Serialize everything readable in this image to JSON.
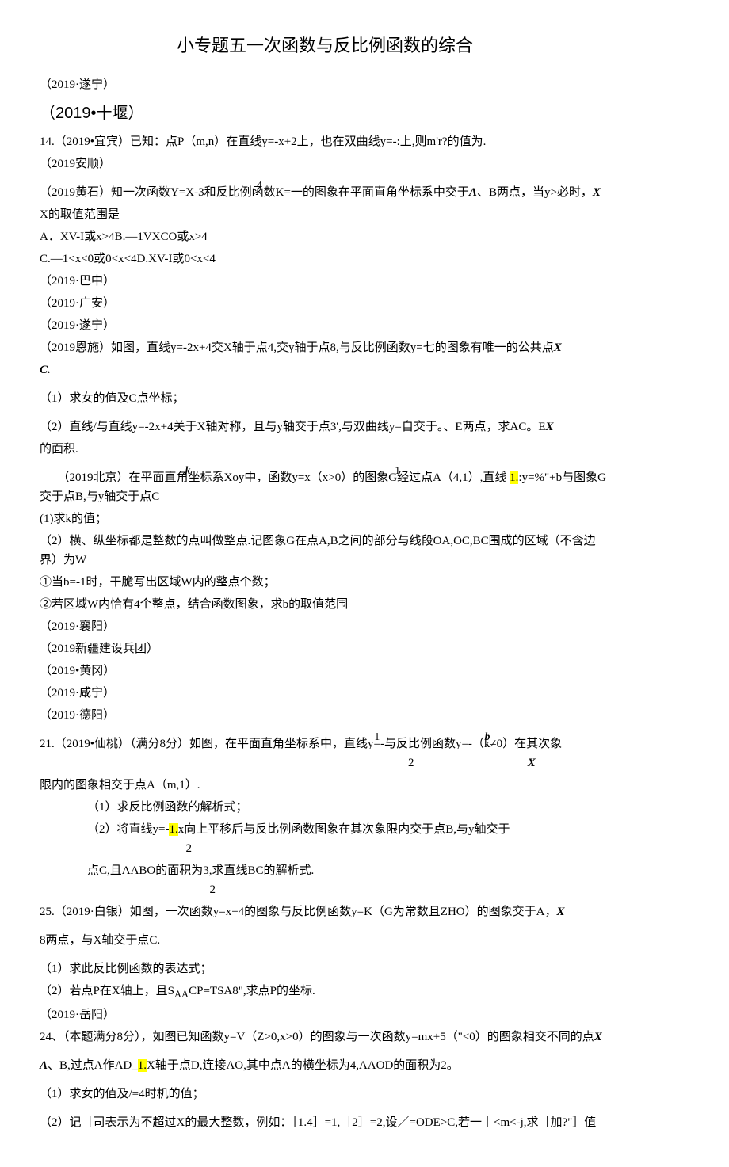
{
  "title": "小专题五一次函数与反比例函数的综合",
  "p1": "（2019·遂宁）",
  "p2": "（2019•十堰）",
  "p3": "14.（2019•宜宾）已知：点P（m,n）在直线y=-x+2上，也在双曲线y=-:上,则m'r?的值为.",
  "p4": "（2019安顺）",
  "p5a": "（2019黄石）知一次函数Y=X-3和反比例函数K=一的图象在平面直角坐标系中交于",
  "p5a_sup": "4",
  "p5_ai": "A",
  "p5b": "、B两点，当y>必时，",
  "p5_xi": "X",
  "p6": "X的取值范围是",
  "p7": "A．XV-I或x>4B.—1VXCO或x>4",
  "p8": "C.—1<x<0或0<x<4D.XV-I或0<x<4",
  "p9": "（2019·巴中）",
  "p10": "（2019·广安）",
  "p11": "（2019·遂宁）",
  "p12a": "（2019恩施）如图，直线y=-2x+4交X轴于点4,交y轴于点8,与反比例函数y=七的图象有唯一的公共点",
  "p12_xi": "X",
  "p13_ci": "C.",
  "p14": "（1）求女的值及C点坐标；",
  "p15a": "（2）直线/与直线y=-2x+4关于X轴对称，且与y轴交于点3',与双曲线y=自交于。、E两点，求AC。E",
  "p15_xi": "X",
  "p16": "的面积.",
  "p17a": "　　（2019北京）在平面直角坐标系Xoy中，函数y=x（x>0）的图象G经过点A（4,1）,直线",
  "p17_sup1": "k",
  "p17_sup2": "1",
  "p17_hl": "1.",
  "p17b": ":y=%\"+b与图象G交于点B,与y轴交于点C",
  "p18": "(1)求k的值；",
  "p19": "（2）横、纵坐标都是整数的点叫做整点.记图象G在点A,B之间的部分与线段OA,OC,BC围成的区域（不含边界）为W",
  "p20": "①当b=-1时，干脆写出区域W内的整点个数；",
  "p21": "②若区域W内恰有4个整点，结合函数图象，求b的取值范围",
  "p22": "（2019·襄阳）",
  "p23": "（2019新疆建设兵团）",
  "p24": "（2019•黄冈）",
  "p25": "（2019·咸宁）",
  "p26": "（2019·德阳）",
  "p27a": "21.（2019•仙桃）（满分8分）如图，在平面直角坐标系中，直线y=-与反比例函数y=-（k≠0）在其次象",
  "p27_sup1": "1",
  "p27_sup2": "b",
  "p27_sub1": "2",
  "p27_sub2": "X",
  "p28": "限内的图象相交于点A（m,1）.",
  "p29": "（1）求反比例函数的解析式；",
  "p30a": "（2）将直线y=-",
  "p30_hl": "1.",
  "p30b": "x向上平移后与反比例函数图象在其次象限内交于点B,与y轴交于",
  "p30_sub": "2",
  "p31a": "点C,且AABO的面积为3,求直线BC的解析式.",
  "p31_sub": "2",
  "p32a": "25.（2019·白银）如图，一次函数y=x+4的图象与反比例函数y=K（G为常数且ZHO）的图象交于A，",
  "p32_xi": "X",
  "p33": "8两点，与X轴交于点C.",
  "p34": "（1）求此反比例函数的表达式；",
  "p35": "（2）若点P在X轴上，且S",
  "p35_sub": "AA",
  "p35b": "CP=TSA8\",求点P的坐标.",
  "p36": "（2019·岳阳）",
  "p37a": "24、（本题满分8分），如图已知函数y=V（Z>0,x>0）的图象与一次函数y=mx+5（\"<0）的图象相交不同的点",
  "p37_xi": "X",
  "p38a_ai": "A",
  "p38a": "、B,过点A作AD_",
  "p38_hl": "1.",
  "p38b": "X轴于点D,连接AO,其中点A的横坐标为4,AAOD的面积为2。",
  "p39": "（1）求女的值及/=4时机的值；",
  "p40": "（2）记［司表示为不超过X的最大整数，例如：［1.4］=1,［2］=2,设／=ODE>C,若一｜<m<-j,求［加?\"］值"
}
